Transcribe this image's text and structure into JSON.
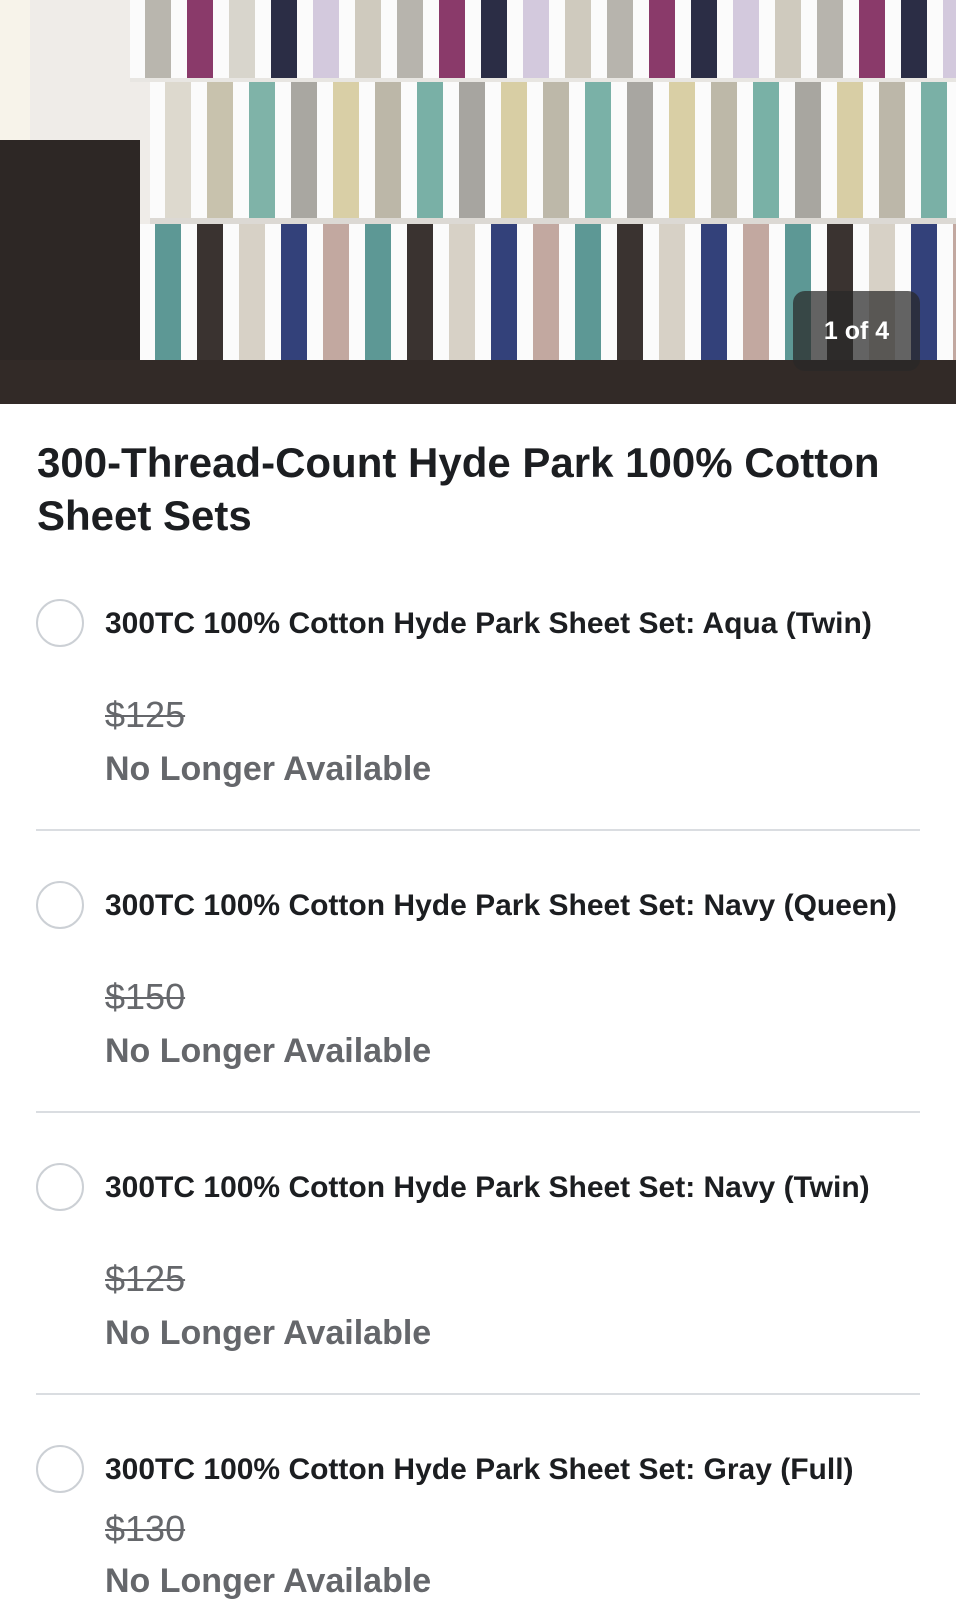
{
  "gallery": {
    "counter": "1 of 4"
  },
  "product": {
    "title": "300-Thread-Count Hyde Park 100% Cotton Sheet Sets"
  },
  "options": [
    {
      "name": "300TC 100% Cotton Hyde Park Sheet Set: Aqua (Twin)",
      "price": "$125",
      "status": "No Longer Available"
    },
    {
      "name": "300TC 100% Cotton Hyde Park Sheet Set: Navy (Queen)",
      "price": "$150",
      "status": "No Longer Available"
    },
    {
      "name": "300TC 100% Cotton Hyde Park Sheet Set: Navy (Twin)",
      "price": "$125",
      "status": "No Longer Available"
    },
    {
      "name": "300TC 100% Cotton Hyde Park Sheet Set: Gray (Full)",
      "price": "$130",
      "status": "No Longer Available"
    }
  ]
}
